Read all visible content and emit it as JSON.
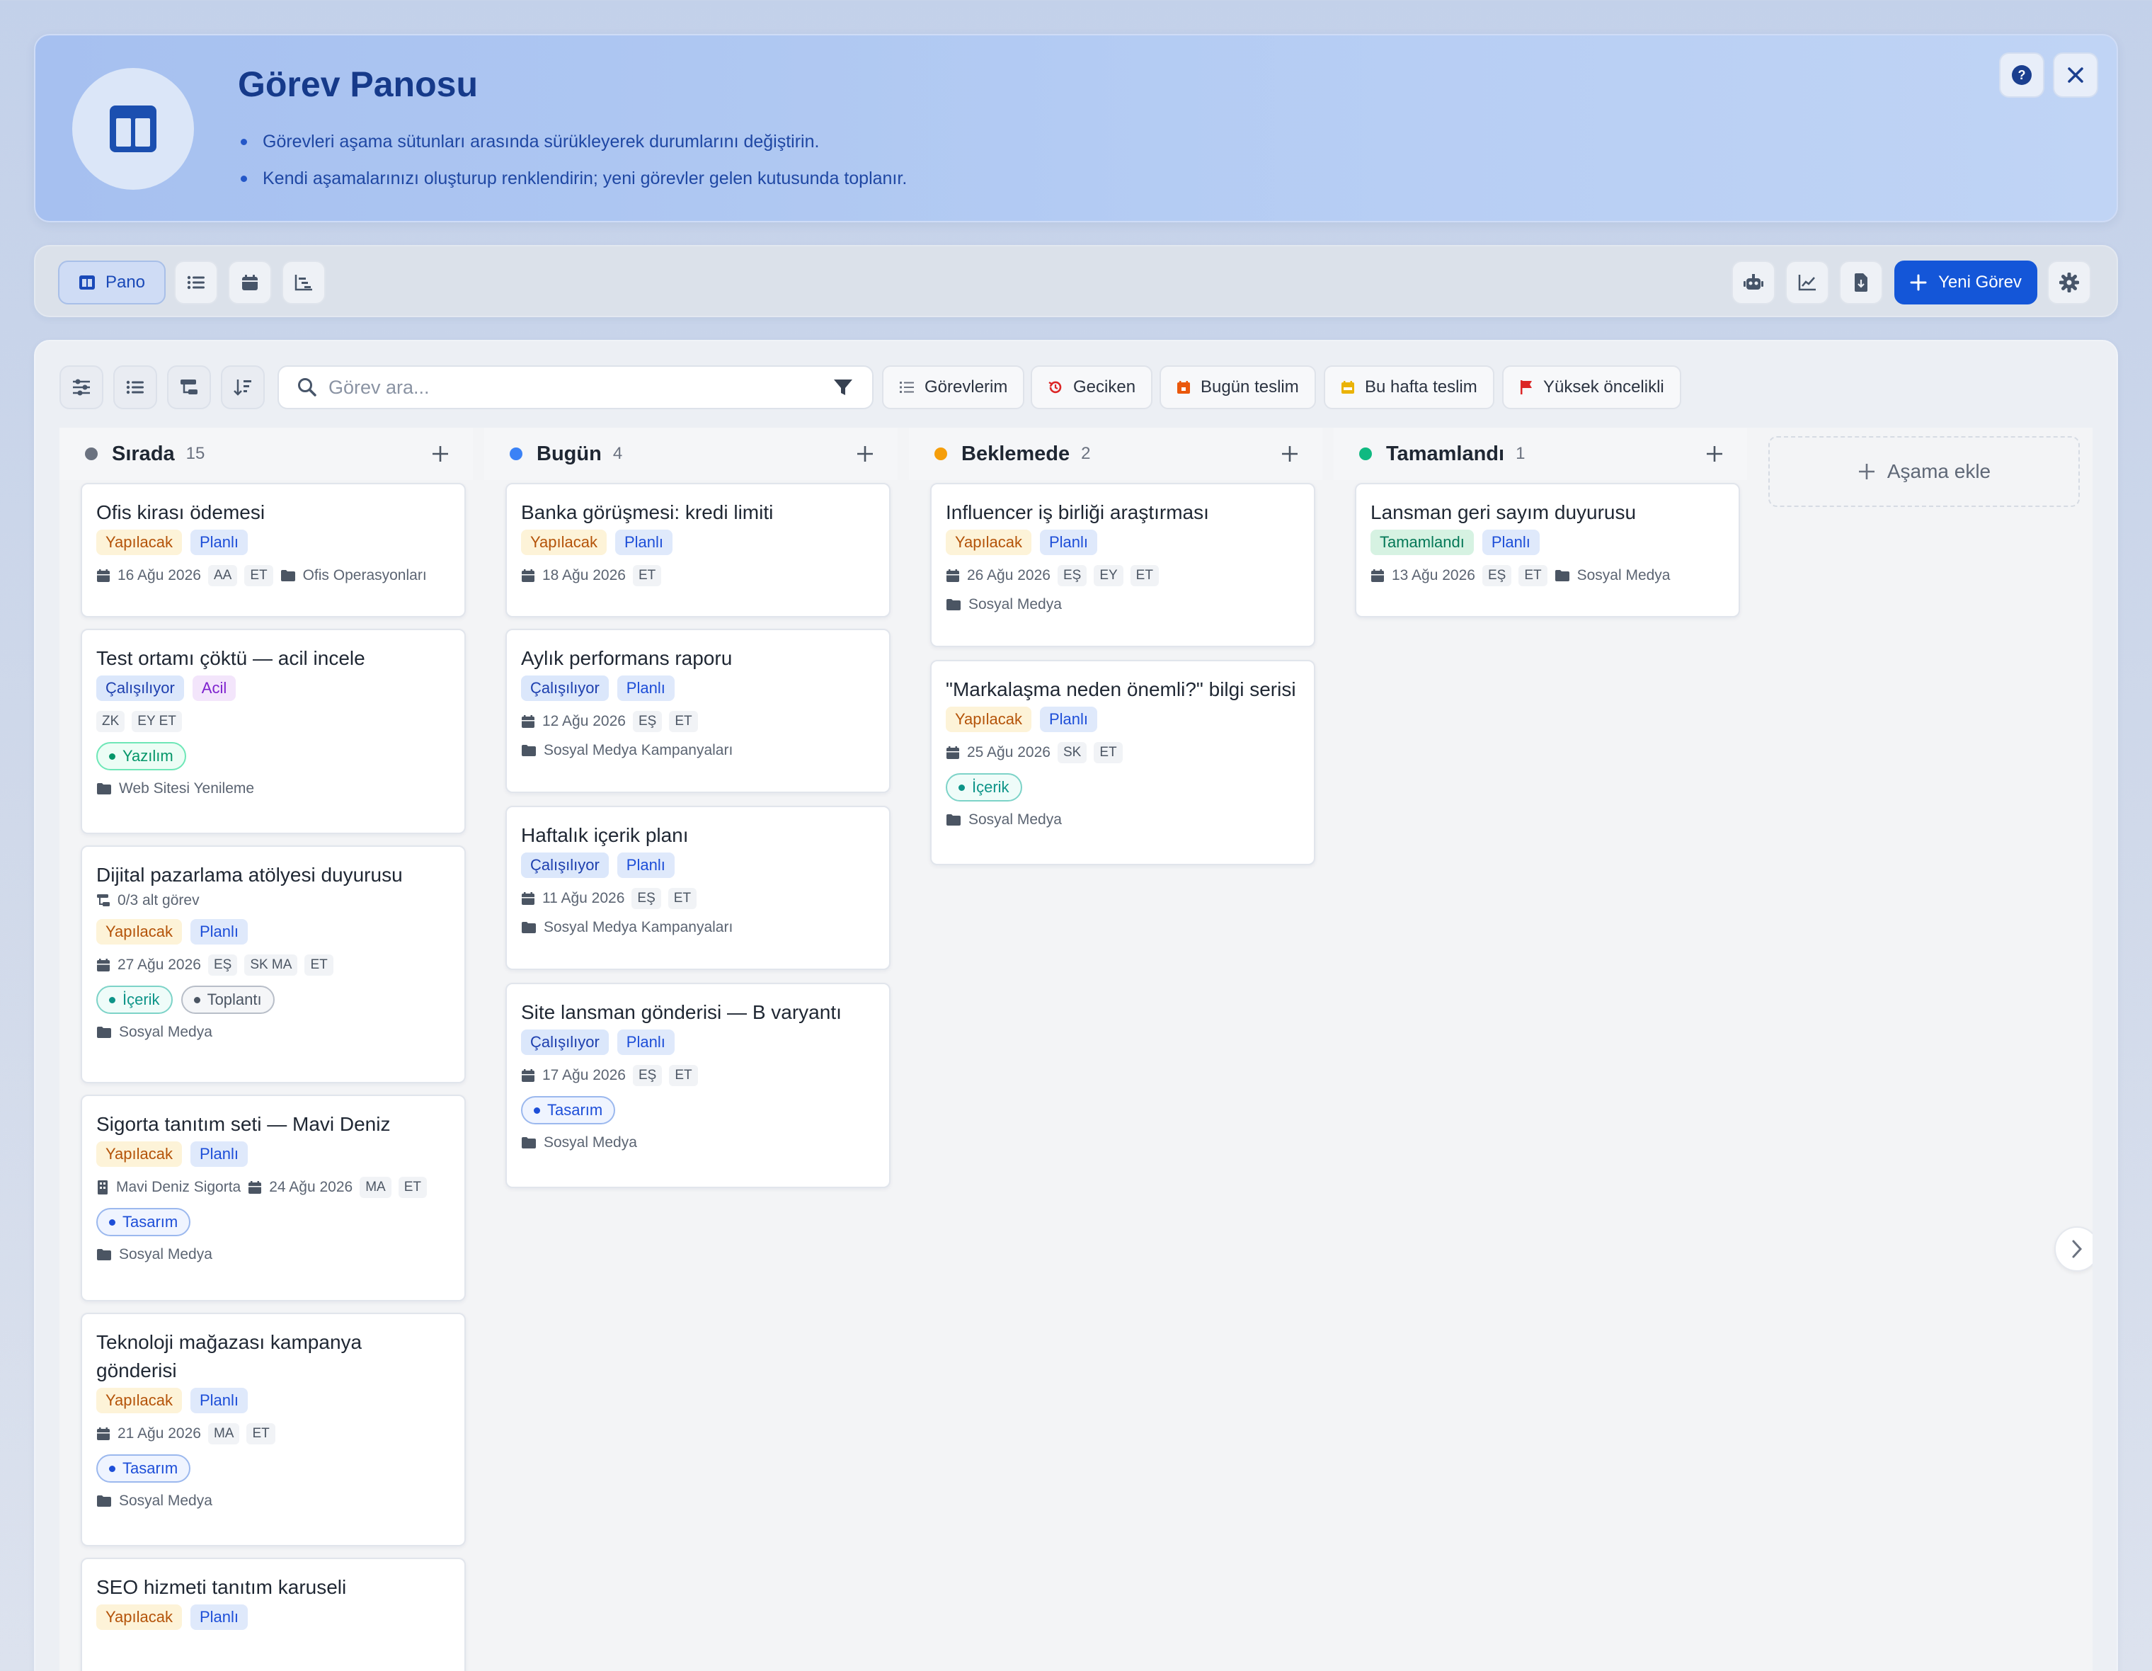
{
  "banner": {
    "title": "Görev Panosu",
    "tips": [
      "Görevleri aşama sütunları arasında sürükleyerek durumlarını değiştirin.",
      "Kendi aşamalarınızı oluşturup renklendirin; yeni görevler gelen kutusunda toplanır."
    ],
    "icon": "board-layout-icon"
  },
  "toolbar": {
    "views": {
      "board": "Pano",
      "list_icon": "list-icon",
      "calendar_icon": "calendar-icon",
      "gantt_icon": "gantt-icon"
    },
    "new_task": "Yeni Görev"
  },
  "filters": {
    "search_placeholder": "Görev ara...",
    "chips": [
      "Görevlerim",
      "Geciken",
      "Bugün teslim",
      "Bu hafta teslim",
      "Yüksek öncelikli"
    ]
  },
  "colors": {
    "accent": "#1456d8",
    "todo": "#6b7280",
    "today": "#3b82f6",
    "waiting": "#f59e0b",
    "done": "#10b981"
  },
  "columns": [
    {
      "name": "Sırada",
      "count": "15",
      "cards": [
        {
          "title": "Ofis kirası ödemesi",
          "status": "Yapılacak",
          "plan": "Planlı",
          "date": "16 Ağu 2026",
          "initials": [
            "AA",
            "ET"
          ],
          "project": "Ofis Operasyonları"
        },
        {
          "title": "Test ortamı çöktü — acil incele",
          "status": "Çalışılıyor",
          "plan": "Acil",
          "initials": [
            "ZK",
            "EY ET"
          ],
          "tag": "Yazılım",
          "project": "Web Sitesi Yenileme"
        },
        {
          "title": "Dijital pazarlama atölyesi duyurusu",
          "subtasks": "0/3 alt görev",
          "status": "Yapılacak",
          "plan": "Planlı",
          "date": "27 Ağu 2026",
          "initials": [
            "EŞ",
            "SK MA",
            "ET"
          ],
          "tags": [
            "İçerik",
            "Toplantı"
          ],
          "project": "Sosyal Medya"
        },
        {
          "title": "Sigorta tanıtım seti — Mavi Deniz",
          "status": "Yapılacak",
          "plan": "Planlı",
          "client": "Mavi Deniz Sigorta",
          "date": "24 Ağu 2026",
          "initials": [
            "MA",
            "ET"
          ],
          "tag": "Tasarım",
          "project": "Sosyal Medya"
        },
        {
          "title": "Teknoloji mağazası kampanya gönderisi",
          "status": "Yapılacak",
          "plan": "Planlı",
          "date": "21 Ağu 2026",
          "initials": [
            "MA",
            "ET"
          ],
          "tag": "Tasarım",
          "project": "Sosyal Medya"
        },
        {
          "title": "SEO hizmeti tanıtım karuseli",
          "status": "Yapılacak",
          "plan": "Planlı"
        }
      ]
    },
    {
      "name": "Bugün",
      "count": "4",
      "cards": [
        {
          "title": "Banka görüşmesi: kredi limiti",
          "status": "Yapılacak",
          "plan": "Planlı",
          "date": "18 Ağu 2026",
          "initials": [
            "ET"
          ]
        },
        {
          "title": "Aylık performans raporu",
          "status": "Çalışılıyor",
          "plan": "Planlı",
          "date": "12 Ağu 2026",
          "initials": [
            "EŞ",
            "ET"
          ],
          "project": "Sosyal Medya Kampanyaları"
        },
        {
          "title": "Haftalık içerik planı",
          "status": "Çalışılıyor",
          "plan": "Planlı",
          "date": "11 Ağu 2026",
          "initials": [
            "EŞ",
            "ET"
          ],
          "project": "Sosyal Medya Kampanyaları"
        },
        {
          "title": "Site lansman gönderisi — B varyantı",
          "status": "Çalışılıyor",
          "plan": "Planlı",
          "date": "17 Ağu 2026",
          "initials": [
            "EŞ",
            "ET"
          ],
          "tag": "Tasarım",
          "project": "Sosyal Medya"
        }
      ]
    },
    {
      "name": "Beklemede",
      "count": "2",
      "cards": [
        {
          "title": "Influencer iş birliği araştırması",
          "status": "Yapılacak",
          "plan": "Planlı",
          "date": "26 Ağu 2026",
          "initials": [
            "EŞ",
            "EY",
            "ET"
          ],
          "project": "Sosyal Medya"
        },
        {
          "title": "\"Markalaşma neden önemli?\" bilgi serisi",
          "status": "Yapılacak",
          "plan": "Planlı",
          "date": "25 Ağu 2026",
          "initials": [
            "SK",
            "ET"
          ],
          "tag": "İçerik",
          "project": "Sosyal Medya"
        }
      ]
    },
    {
      "name": "Tamamlandı",
      "count": "1",
      "cards": [
        {
          "title": "Lansman geri sayım duyurusu",
          "status": "Tamamlandı",
          "plan": "Planlı",
          "date": "13 Ağu 2026",
          "initials": [
            "EŞ",
            "ET"
          ],
          "project": "Sosyal Medya"
        }
      ]
    }
  ],
  "add_stage": "Aşama ekle"
}
